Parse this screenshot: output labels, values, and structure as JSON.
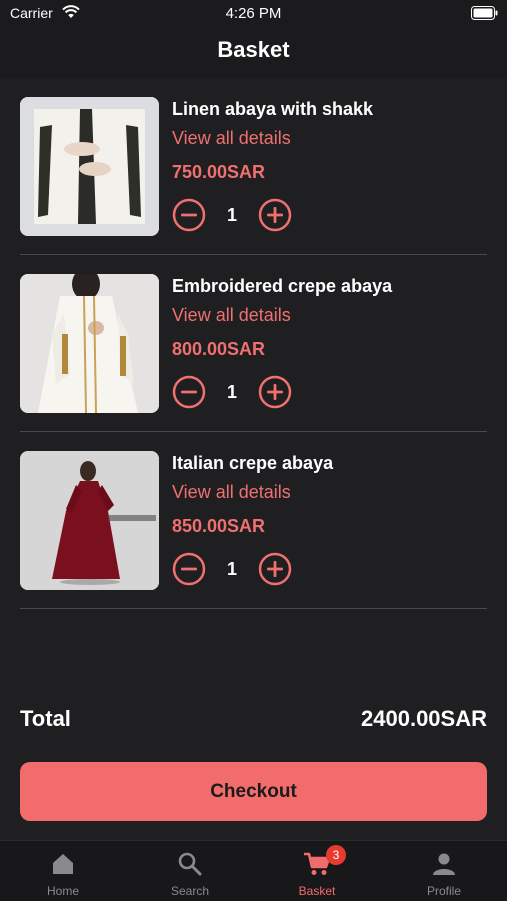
{
  "status_bar": {
    "carrier": "Carrier",
    "time": "4:26 PM"
  },
  "header": {
    "title": "Basket"
  },
  "items": [
    {
      "name": "Linen abaya with shakk",
      "details_link": "View all details",
      "price": "750.00SAR",
      "quantity": "1"
    },
    {
      "name": "Embroidered crepe abaya",
      "details_link": "View all details",
      "price": "800.00SAR",
      "quantity": "1"
    },
    {
      "name": "Italian crepe abaya",
      "details_link": "View all details",
      "price": "850.00SAR",
      "quantity": "1"
    }
  ],
  "summary": {
    "total_label": "Total",
    "total_value": "2400.00SAR"
  },
  "checkout": {
    "label": "Checkout"
  },
  "tab_bar": {
    "tabs": [
      {
        "label": "Home",
        "icon": "home-icon"
      },
      {
        "label": "Search",
        "icon": "search-icon"
      },
      {
        "label": "Basket",
        "icon": "cart-icon",
        "badge": "3",
        "active": true
      },
      {
        "label": "Profile",
        "icon": "person-icon"
      }
    ]
  },
  "colors": {
    "accent": "#f36c6c",
    "background": "#1f1f21",
    "badge": "#e63b2e"
  }
}
